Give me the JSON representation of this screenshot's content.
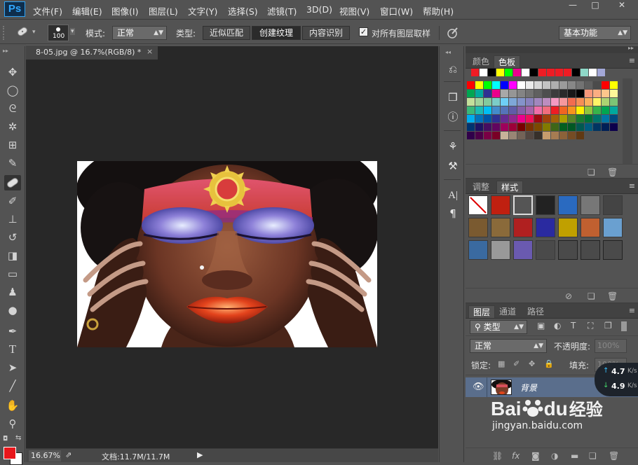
{
  "app": {
    "logo": "Ps"
  },
  "menu": [
    "文件(F)",
    "编辑(E)",
    "图像(I)",
    "图层(L)",
    "文字(Y)",
    "选择(S)",
    "滤镜(T)",
    "3D(D)",
    "视图(V)",
    "窗口(W)",
    "帮助(H)"
  ],
  "window_controls": {
    "minimize": "—",
    "restore": "□",
    "close": "✕"
  },
  "options": {
    "brush_size": "100",
    "mode_label": "模式:",
    "mode_value": "正常",
    "type_label": "类型:",
    "type_options": [
      "近似匹配",
      "创建纹理",
      "内容识别"
    ],
    "type_selected": "创建纹理",
    "sample_all_label": "对所有图层取样",
    "sample_all_checked": true,
    "workspace": "基本功能"
  },
  "document": {
    "tab_title": "8-05.jpg @ 16.7%(RGB/8) *",
    "close_glyph": "×",
    "zoom": "16.67%",
    "doc_size": "文档:11.7M/11.7M"
  },
  "tools": [
    "move-tool",
    "marquee-tool",
    "lasso-tool",
    "magic-wand-tool",
    "crop-tool",
    "eyedropper-tool",
    "spot-healing-tool",
    "brush-tool",
    "clone-stamp-tool",
    "history-brush-tool",
    "eraser-tool",
    "gradient-tool",
    "blur-tool",
    "dodge-tool",
    "pen-tool",
    "type-tool",
    "path-selection-tool",
    "line-tool",
    "hand-tool",
    "zoom-tool"
  ],
  "colors": {
    "foreground": "#e8161b",
    "background": "#ffffff",
    "accent": "#31a8ff",
    "selected_layer": "#5a6e8c"
  },
  "swatches_panel": {
    "tabs": [
      "颜色",
      "色板"
    ],
    "active_tab": "色板",
    "recent": [
      "#ee1c24",
      "#ffffff",
      "#000000",
      "#ffff00",
      "#00ff00",
      "#ec008c",
      "#ffffff",
      "#000000",
      "#ee1c24",
      "#ee1c24",
      "#ee1c24",
      "#ee1c24",
      "#000000",
      "#8fd8c8",
      "#ffffff",
      "#a3a8d8"
    ],
    "grid": [
      [
        "#ff0000",
        "#ffff00",
        "#00ff00",
        "#00ffff",
        "#0000ff",
        "#ff00ff",
        "#ffffff",
        "#ebebeb",
        "#d7d7d7",
        "#c3c3c3",
        "#afafaf",
        "#9b9b9b",
        "#878787",
        "#737373",
        "#5f5f5f",
        "#4b4b4b",
        "#ff0000",
        "#ffff00"
      ],
      [
        "#00a651",
        "#00a99d",
        "#2e3192",
        "#ec008c",
        "#a8a8a8",
        "#969696",
        "#848484",
        "#727272",
        "#606060",
        "#4e4e4e",
        "#3c3c3c",
        "#2a2a2a",
        "#181818",
        "#000000",
        "#f7977a",
        "#fbad82",
        "#fdc68c",
        "#fff799"
      ],
      [
        "#c4df9b",
        "#a3d39c",
        "#82ca9d",
        "#7bcdc8",
        "#6ecff6",
        "#7ea7d8",
        "#8493ca",
        "#8882be",
        "#a187be",
        "#bc8dbf",
        "#f49ac2",
        "#f6989d",
        "#f26c4f",
        "#f68e56",
        "#fbaf5c",
        "#fff467",
        "#acd372",
        "#7cc576"
      ],
      [
        "#3bb878",
        "#1abbb4",
        "#00bff3",
        "#438ccb",
        "#5574b9",
        "#605ca8",
        "#855fa8",
        "#a763a9",
        "#ef6ea8",
        "#f16d7e",
        "#ee1d24",
        "#f16522",
        "#f7941d",
        "#fff100",
        "#8fc63d",
        "#37b44a",
        "#00a650",
        "#00a99e"
      ],
      [
        "#00aeef",
        "#0072bc",
        "#0054a5",
        "#2f3192",
        "#652c91",
        "#91278f",
        "#ed008c",
        "#ee105a",
        "#9d0a0f",
        "#a1410d",
        "#a36209",
        "#aba000",
        "#588528",
        "#197b30",
        "#007236",
        "#00736a",
        "#0076a4",
        "#004a80"
      ],
      [
        "#003370",
        "#1d1363",
        "#450e61",
        "#62055f",
        "#9e005c",
        "#9d0039",
        "#790000",
        "#7b3000",
        "#7c4900",
        "#827a00",
        "#3e6617",
        "#045f20",
        "#005824",
        "#005951",
        "#005b7e",
        "#003562",
        "#002056",
        "#0c004b"
      ],
      [
        "#30004a",
        "#4b0048",
        "#7a0045",
        "#7a0026",
        "#c7b299",
        "#998675",
        "#736357",
        "#534741",
        "#37302a",
        "#c69c6d",
        "#a67c52",
        "#8c6239",
        "#754c24",
        "#603913"
      ]
    ]
  },
  "styles_panel": {
    "tabs": [
      "调整",
      "样式"
    ],
    "active_tab": "样式",
    "count": 24
  },
  "layers_panel": {
    "tabs": [
      "图层",
      "通道",
      "路径"
    ],
    "active_tab": "图层",
    "filter_kind": "类型",
    "blend_mode": "正常",
    "opacity_label": "不透明度:",
    "opacity_value": "100%",
    "lock_label": "锁定:",
    "fill_label": "填充:",
    "fill_value": "100%",
    "layers": [
      {
        "name": "背景",
        "visible": true
      }
    ],
    "footer_icons": [
      "link-icon",
      "fx-icon",
      "mask-icon",
      "adjustment-icon",
      "folder-icon",
      "new-layer-icon",
      "delete-icon"
    ]
  },
  "network": {
    "upload": "4.7",
    "upload_unit": "K/s",
    "download": "4.9",
    "download_unit": "K/s"
  },
  "watermark": {
    "brand": "Bai",
    "brand2": "du",
    "cn": "经验",
    "url": "jingyan.baidu.com"
  }
}
